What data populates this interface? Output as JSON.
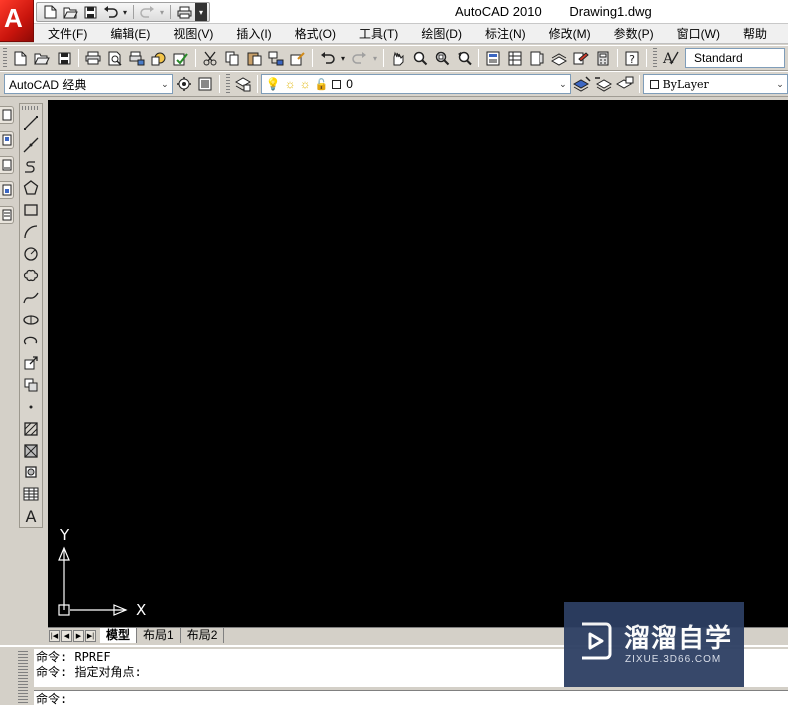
{
  "window": {
    "app_name": "AutoCAD 2010",
    "document_name": "Drawing1.dwg",
    "logo_letter": "A"
  },
  "quick_access": {
    "items": [
      "new-icon",
      "open-icon",
      "save-icon",
      "undo-icon",
      "redo-icon",
      "plot-icon",
      "dropdown-arrow-icon"
    ]
  },
  "menu": {
    "items": [
      {
        "label": "文件(F)"
      },
      {
        "label": "编辑(E)"
      },
      {
        "label": "视图(V)"
      },
      {
        "label": "插入(I)"
      },
      {
        "label": "格式(O)"
      },
      {
        "label": "工具(T)"
      },
      {
        "label": "绘图(D)"
      },
      {
        "label": "标注(N)"
      },
      {
        "label": "修改(M)"
      },
      {
        "label": "参数(P)"
      },
      {
        "label": "窗口(W)"
      },
      {
        "label": "帮助"
      }
    ]
  },
  "standard_toolbar": {
    "text_style": "Standard"
  },
  "workspace_toolbar": {
    "workspace": "AutoCAD 经典",
    "layer": "0",
    "color": "ByLayer"
  },
  "canvas": {
    "background": "#000000",
    "ucs_x_label": "X",
    "ucs_y_label": "Y"
  },
  "layout_tabs": {
    "tabs": [
      {
        "label": "模型",
        "active": true
      },
      {
        "label": "布局1",
        "active": false
      },
      {
        "label": "布局2",
        "active": false
      }
    ]
  },
  "command_line": {
    "history": [
      "命令: RPREF",
      "命令: 指定对角点:"
    ],
    "prompt": "命令:"
  },
  "watermark": {
    "title": "溜溜自学",
    "url": "ZIXUE.3D66.COM"
  },
  "colors": {
    "canvas": "#000000",
    "logo_red": "#d0150c",
    "watermark_bg": "#2d3f63"
  }
}
